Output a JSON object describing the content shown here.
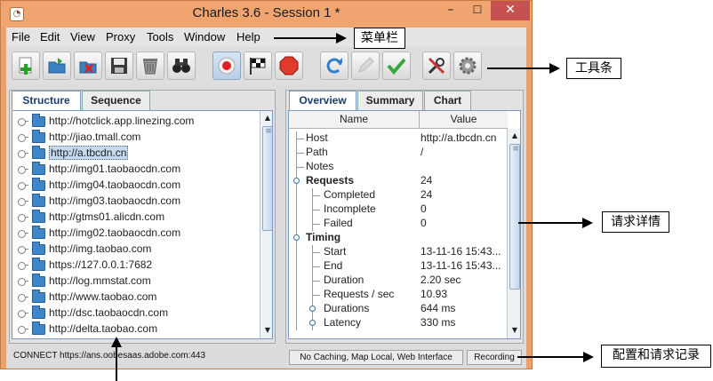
{
  "window": {
    "title": "Charles 3.6 - Session 1 *",
    "minimize": "–",
    "maximize": "☐",
    "close": "✕"
  },
  "menu": [
    {
      "label": "File"
    },
    {
      "label": "Edit"
    },
    {
      "label": "View"
    },
    {
      "label": "Proxy"
    },
    {
      "label": "Tools"
    },
    {
      "label": "Window"
    },
    {
      "label": "Help"
    }
  ],
  "toolbar": [
    {
      "icon": "new-session-icon"
    },
    {
      "icon": "open-icon"
    },
    {
      "icon": "close-session-icon"
    },
    {
      "icon": "save-icon"
    },
    {
      "icon": "clear-trash-icon"
    },
    {
      "icon": "binoculars-find-icon"
    },
    {
      "icon": "record-icon",
      "pressed": true
    },
    {
      "icon": "throttle-flag-icon"
    },
    {
      "icon": "breakpoints-stop-icon"
    },
    {
      "icon": "repeat-icon"
    },
    {
      "icon": "edit-pencil-icon"
    },
    {
      "icon": "validate-check-icon"
    },
    {
      "icon": "tools-icon"
    },
    {
      "icon": "settings-gear-icon"
    }
  ],
  "left_tabs": [
    "Structure",
    "Sequence"
  ],
  "hosts": [
    "http://hotclick.app.linezing.com",
    "http://jiao.tmall.com",
    "http://a.tbcdn.cn",
    "http://img01.taobaocdn.com",
    "http://img04.taobaocdn.com",
    "http://img03.taobaocdn.com",
    "http://gtms01.alicdn.com",
    "http://img02.taobaocdn.com",
    "http://img.taobao.com",
    "https://127.0.0.1:7682",
    "http://log.mmstat.com",
    "http://www.taobao.com",
    "http://dsc.taobaocdn.com",
    "http://delta.taobao.com"
  ],
  "selected_host": "http://a.tbcdn.cn",
  "right_tabs": [
    "Overview",
    "Summary",
    "Chart"
  ],
  "overview": {
    "col_name": "Name",
    "col_value": "Value",
    "rows": [
      {
        "name": "Host",
        "value": "http://a.tbcdn.cn",
        "level": 0,
        "bold": false
      },
      {
        "name": "Path",
        "value": "/",
        "level": 0,
        "bold": false
      },
      {
        "name": "Notes",
        "value": "",
        "level": 0,
        "bold": false
      },
      {
        "name": "Requests",
        "value": "24",
        "level": 0,
        "bold": true,
        "toggle": true
      },
      {
        "name": "Completed",
        "value": "24",
        "level": 1,
        "bold": false
      },
      {
        "name": "Incomplete",
        "value": "0",
        "level": 1,
        "bold": false
      },
      {
        "name": "Failed",
        "value": "0",
        "level": 1,
        "bold": false
      },
      {
        "name": "Timing",
        "value": "",
        "level": 0,
        "bold": true,
        "toggle": true
      },
      {
        "name": "Start",
        "value": "13-11-16 15:43...",
        "level": 1,
        "bold": false
      },
      {
        "name": "End",
        "value": "13-11-16 15:43...",
        "level": 1,
        "bold": false
      },
      {
        "name": "Duration",
        "value": "2.20 sec",
        "level": 1,
        "bold": false
      },
      {
        "name": "Requests / sec",
        "value": "10.93",
        "level": 1,
        "bold": false
      },
      {
        "name": "Durations",
        "value": "644 ms",
        "level": 1,
        "bold": false,
        "toggle": true
      },
      {
        "name": "Latency",
        "value": "330 ms",
        "level": 1,
        "bold": false,
        "toggle": true
      }
    ]
  },
  "status": {
    "text": "CONNECT https://ans.oobesaas.adobe.com:443",
    "settings": "No Caching, Map Local, Web Interface",
    "recording": "Recording"
  },
  "annotations": {
    "menubar": "菜单栏",
    "toolbar": "工具条",
    "details": "请求详情",
    "config": "配置和请求记录"
  }
}
